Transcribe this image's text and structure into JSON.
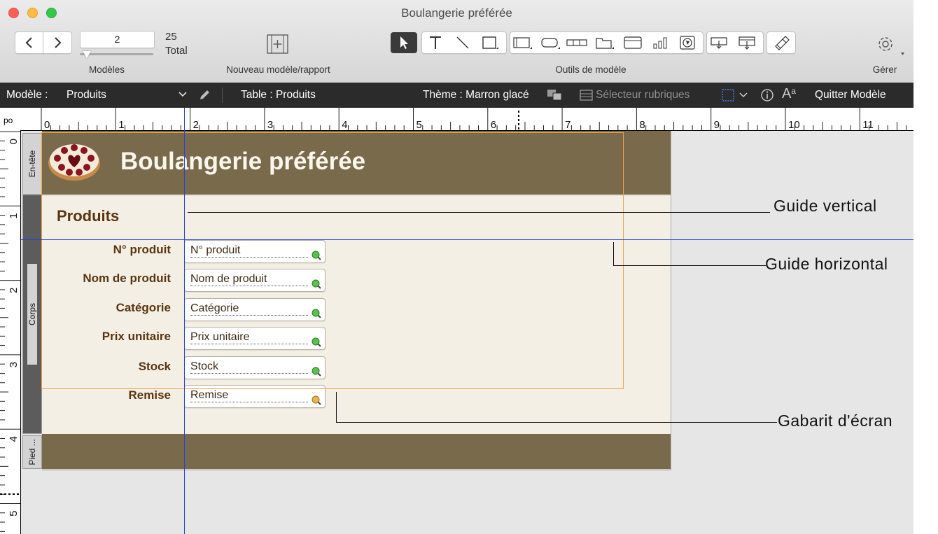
{
  "window": {
    "title": "Boulangerie préférée"
  },
  "toolbar": {
    "record_number": "2",
    "total_count": "25",
    "total_label": "Total",
    "layouts_label": "Modèles",
    "new_layout_label": "Nouveau modèle/rapport",
    "layout_tools_label": "Outils de modèle",
    "manage_label": "Gérer"
  },
  "format_bar": {
    "layout_prefix": "Modèle :",
    "layout_name": "Produits",
    "table_label": "Table : Produits",
    "theme_label": "Thème : Marron glacé",
    "field_picker_label": "Sélecteur rubriques",
    "exit_layout_label": "Quitter Modèle"
  },
  "rulers": {
    "unit": "po",
    "top_numbers": [
      "0",
      "1",
      "2",
      "3",
      "4",
      "5",
      "6",
      "7",
      "8",
      "9",
      "10",
      "11"
    ],
    "left_numbers": [
      "0",
      "1",
      "2",
      "3",
      "4",
      "5"
    ]
  },
  "layout": {
    "header_tab": "En-tête",
    "body_tab": "Corps",
    "footer_tab": "Pied ...",
    "header_title": "Boulangerie préférée",
    "section_title": "Produits",
    "fields": [
      {
        "label": "N° produit",
        "value": "N° produit"
      },
      {
        "label": "Nom de produit",
        "value": "Nom de produit"
      },
      {
        "label": "Catégorie",
        "value": "Catégorie"
      },
      {
        "label": "Prix unitaire",
        "value": "Prix unitaire"
      },
      {
        "label": "Stock",
        "value": "Stock"
      },
      {
        "label": "Remise",
        "value": "Remise"
      }
    ]
  },
  "callouts": {
    "vertical_guide": "Guide vertical",
    "horizontal_guide": "Guide horizontal",
    "screen_stencil": "Gabarit d'écran"
  },
  "colors": {
    "band_brown": "#7a6a4c",
    "body_cream": "#f3efe5",
    "label_brown": "#5a3510",
    "guide_blue": "#2a3fd8",
    "stencil_orange": "#f0a24a"
  }
}
